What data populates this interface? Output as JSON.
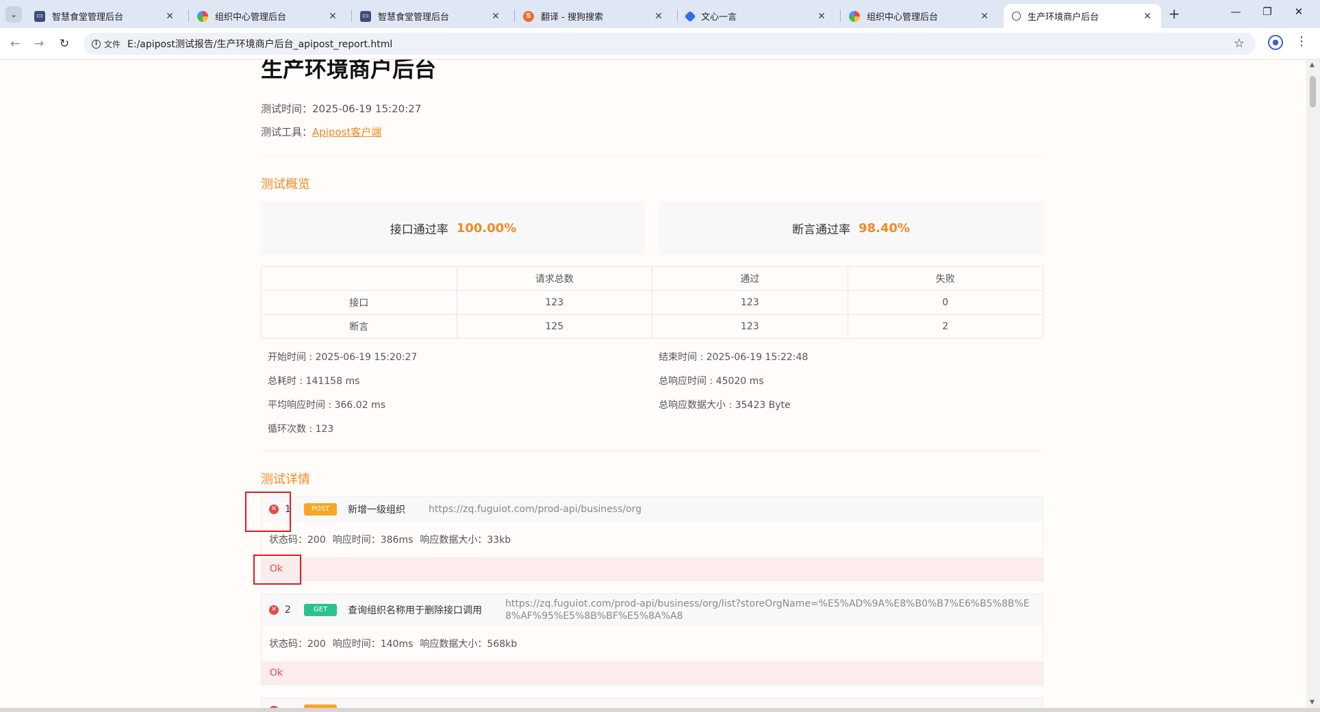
{
  "browser": {
    "tabs": [
      {
        "title": "智慧食堂管理后台",
        "icon": "page-icon"
      },
      {
        "title": "组织中心管理后台",
        "icon": "colorful-logo-icon"
      },
      {
        "title": "智慧食堂管理后台",
        "icon": "page-icon"
      },
      {
        "title": "翻译 - 搜狗搜索",
        "icon": "sogou-icon"
      },
      {
        "title": "文心一言",
        "icon": "wenxin-icon"
      },
      {
        "title": "组织中心管理后台",
        "icon": "colorful-logo-icon"
      },
      {
        "title": "生产环境商户后台",
        "icon": "globe-icon",
        "active": true
      }
    ],
    "address_info_label": "文件",
    "url": "E:/apipost测试报告/生产环境商户后台_apipost_report.html"
  },
  "report": {
    "title": "生产环境商户后台",
    "test_time_label": "测试时间：",
    "test_time": "2025-06-19 15:20:27",
    "test_tool_label": "测试工具：",
    "test_tool": "Apipost客户端",
    "overview_title": "测试概览",
    "api_pass_rate_label": "接口通过率",
    "api_pass_rate": "100.00%",
    "assert_pass_rate_label": "断言通过率",
    "assert_pass_rate": "98.40%",
    "summary_table": {
      "headers": [
        "",
        "请求总数",
        "通过",
        "失败"
      ],
      "rows": [
        [
          "接口",
          "123",
          "123",
          "0"
        ],
        [
          "断言",
          "125",
          "123",
          "2"
        ]
      ]
    },
    "stats": {
      "start_time": "开始时间 : 2025-06-19 15:20:27",
      "end_time": "结束时间 : 2025-06-19 15:22:48",
      "total_duration": "总耗时 : 141158 ms",
      "total_response_time": "总响应时间 : 45020 ms",
      "avg_response_time": "平均响应时间 : 366.02 ms",
      "total_response_size": "总响应数据大小 : 35423 Byte",
      "loop_count": "循环次数 : 123"
    },
    "details_title": "测试详情",
    "cases": [
      {
        "index": "1",
        "method": "POST",
        "name": "新增一级组织",
        "url": "https://zq.fuguiot.com/prod-api/business/org",
        "status": "状态码：200",
        "response_time": "响应时间：386ms",
        "response_size": "响应数据大小：33kb",
        "message": "Ok"
      },
      {
        "index": "2",
        "method": "GET",
        "name": "查询组织名称用于删除接口调用",
        "url": "https://zq.fuguiot.com/prod-api/business/org/list?storeOrgName=%E5%AD%9A%E8%B0%B7%E6%B5%8B%E8%AF%95%E5%8B%BF%E5%8A%A8",
        "status": "状态码：200",
        "response_time": "响应时间：140ms",
        "response_size": "响应数据大小：568kb",
        "message": "Ok"
      }
    ]
  },
  "colors": {
    "accent": "#f08a24",
    "fail": "#e34b4b",
    "post": "#f6a623",
    "get": "#2bc28f",
    "highlight_box": "#e0191f"
  }
}
